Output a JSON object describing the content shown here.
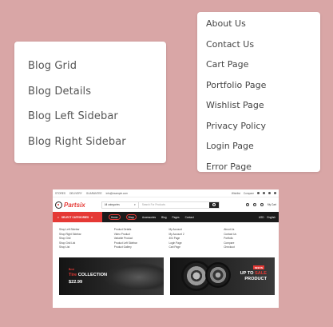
{
  "left_menu": {
    "items": [
      {
        "label": "Blog Grid"
      },
      {
        "label": "Blog Details"
      },
      {
        "label": "Blog Left Sidebar"
      },
      {
        "label": "Blog Right Sidebar"
      }
    ]
  },
  "right_menu": {
    "items": [
      {
        "label": "About Us"
      },
      {
        "label": "Contact Us"
      },
      {
        "label": "Cart Page"
      },
      {
        "label": "Portfolio Page"
      },
      {
        "label": "Wishlist Page"
      },
      {
        "label": "Privacy Policy"
      },
      {
        "label": "Login Page"
      },
      {
        "label": "Error Page"
      }
    ]
  },
  "preview": {
    "topbar": {
      "links": [
        "STORES",
        "DELIVERY",
        "GUARANTEE",
        "info@example.com"
      ],
      "wishlist": "Wishlist",
      "compare": "Compare"
    },
    "header": {
      "logo": "Partsix",
      "category_select": "All categories",
      "search_placeholder": "Search For Products",
      "cart_label": "My Cart"
    },
    "navbar": {
      "category_button": "SELECT CATEGORIES",
      "menu": [
        {
          "label": "Home"
        },
        {
          "label": "Shop"
        },
        {
          "label": "Accessories"
        },
        {
          "label": "Blog"
        },
        {
          "label": "Pages"
        },
        {
          "label": "Contact"
        }
      ],
      "currency": "USD",
      "language": "English"
    },
    "mega": {
      "columns": [
        [
          "Shop Left Sidebar",
          "Shop Right Sidebar",
          "Shop Grid",
          "Shop Grid List",
          "Shop List"
        ],
        [
          "Product Details",
          "Video Product",
          "Variable Product",
          "Product Left Sidebar",
          "Product Gallery"
        ],
        [
          "My Account",
          "My Account 2",
          "404 Page",
          "Login Page",
          "Cart Page"
        ],
        [
          "About Us",
          "Contact Us",
          "Portfolio",
          "Compare",
          "Checkout"
        ]
      ]
    },
    "banners": [
      {
        "tag": "Best",
        "title_a": "Tire",
        "title_b": "COLLECTION",
        "price": "$22.99"
      },
      {
        "badge": "NEW IN",
        "title_a": "UP TO",
        "title_b": "SALE",
        "title_c": "PRODUCT"
      }
    ]
  }
}
